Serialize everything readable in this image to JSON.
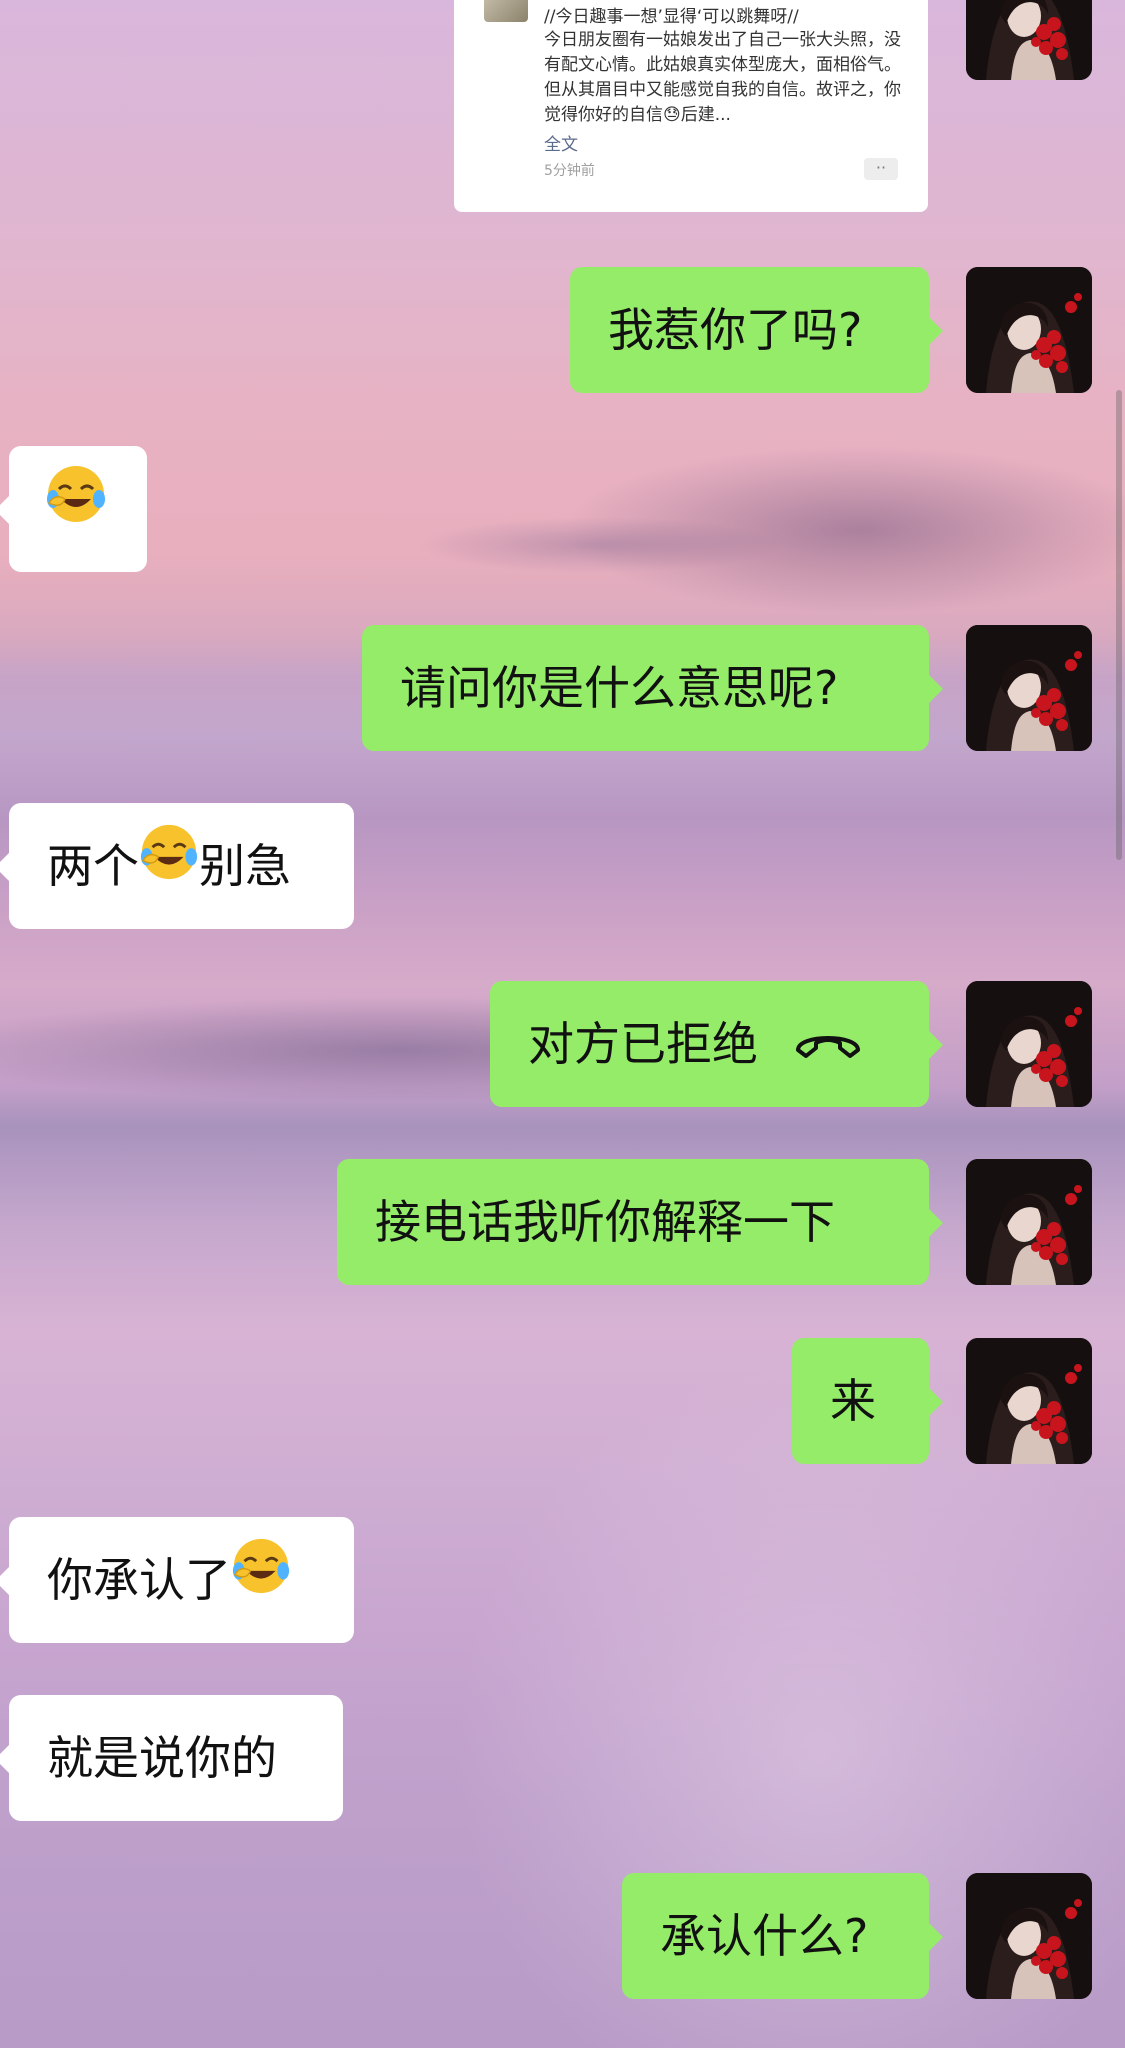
{
  "shared_post": {
    "title": "//今日趣事一想’显得‘可以跳舞呀//",
    "body": "今日朋友圈有一姑娘发出了自己一张大头照，没有配文心情。此姑娘真实体型庞大，面相俗气。但从其眉目中又能感觉自我的自信。故评之，你觉得你好的自信😓后建...",
    "full_text_label": "全文",
    "timestamp": "5分钟前",
    "more_label": "··"
  },
  "messages": [
    {
      "side": "right",
      "text": "我惹你了吗?"
    },
    {
      "side": "left",
      "text": "",
      "emoji": "sweat-laugh-emoji"
    },
    {
      "side": "right",
      "text": "请问你是什么意思呢?"
    },
    {
      "side": "left",
      "text_before": "两个",
      "emoji": "sweat-laugh-emoji",
      "text_after": "别急"
    },
    {
      "side": "right",
      "text": "对方已拒绝",
      "icon": "call-declined-icon"
    },
    {
      "side": "right",
      "text": "接电话我听你解释一下"
    },
    {
      "side": "right",
      "text": "来"
    },
    {
      "side": "left",
      "text_before": "你承认了",
      "emoji": "sweat-laugh-emoji"
    },
    {
      "side": "left",
      "text": "就是说你的"
    },
    {
      "side": "right",
      "text": "承认什么?"
    }
  ],
  "colors": {
    "bubble_right": "#95ec69",
    "bubble_left": "#ffffff"
  }
}
